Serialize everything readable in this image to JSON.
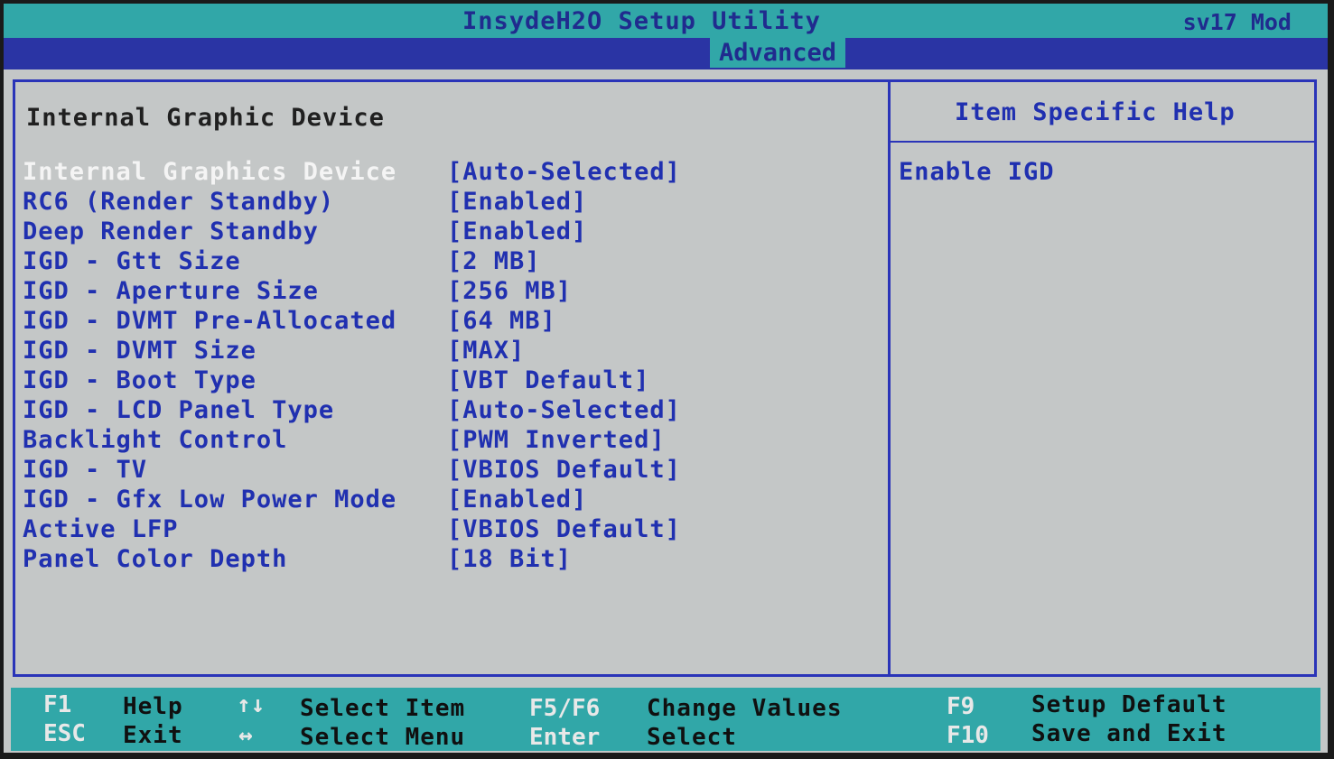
{
  "title_bar": {
    "title": "InsydeH2O Setup Utility",
    "mod": "sv17 Mod"
  },
  "tabs": {
    "active": "Advanced"
  },
  "main": {
    "section_title": "Internal Graphic Device",
    "rows": [
      {
        "label": "Internal Graphics Device",
        "value": "[Auto-Selected]",
        "selected": true
      },
      {
        "label": "RC6 (Render Standby)",
        "value": "[Enabled]"
      },
      {
        "label": "Deep Render Standby",
        "value": "[Enabled]"
      },
      {
        "label": "IGD - Gtt Size",
        "value": "[2 MB]"
      },
      {
        "label": "IGD - Aperture Size",
        "value": "[256 MB]"
      },
      {
        "label": "IGD - DVMT Pre-Allocated",
        "value": "[64 MB]"
      },
      {
        "label": "IGD - DVMT Size",
        "value": "[MAX]"
      },
      {
        "label": "IGD - Boot Type",
        "value": "[VBT Default]"
      },
      {
        "label": "IGD - LCD Panel Type",
        "value": "[Auto-Selected]"
      },
      {
        "label": "Backlight Control",
        "value": "[PWM Inverted]"
      },
      {
        "label": "IGD - TV",
        "value": "[VBIOS Default]"
      },
      {
        "label": "IGD - Gfx Low Power Mode",
        "value": "[Enabled]"
      },
      {
        "label": "Active LFP",
        "value": "[VBIOS Default]"
      },
      {
        "label": "Panel Color Depth",
        "value": "[18 Bit]"
      }
    ]
  },
  "help": {
    "title": "Item Specific Help",
    "text": "Enable IGD"
  },
  "footer": {
    "f1_key": "F1",
    "f1_desc": "Help",
    "esc_key": "ESC",
    "esc_desc": "Exit",
    "updown_key": "↑↓",
    "updown_desc": "Select Item",
    "leftright_key": "↔",
    "leftright_desc": "Select Menu",
    "f5f6_key": "F5/F6",
    "f5f6_desc": "Change Values",
    "enter_key": "Enter",
    "enter_desc": "Select",
    "f9_key": "F9",
    "f9_desc": "Setup Default",
    "f10_key": "F10",
    "f10_desc": "Save and Exit"
  }
}
